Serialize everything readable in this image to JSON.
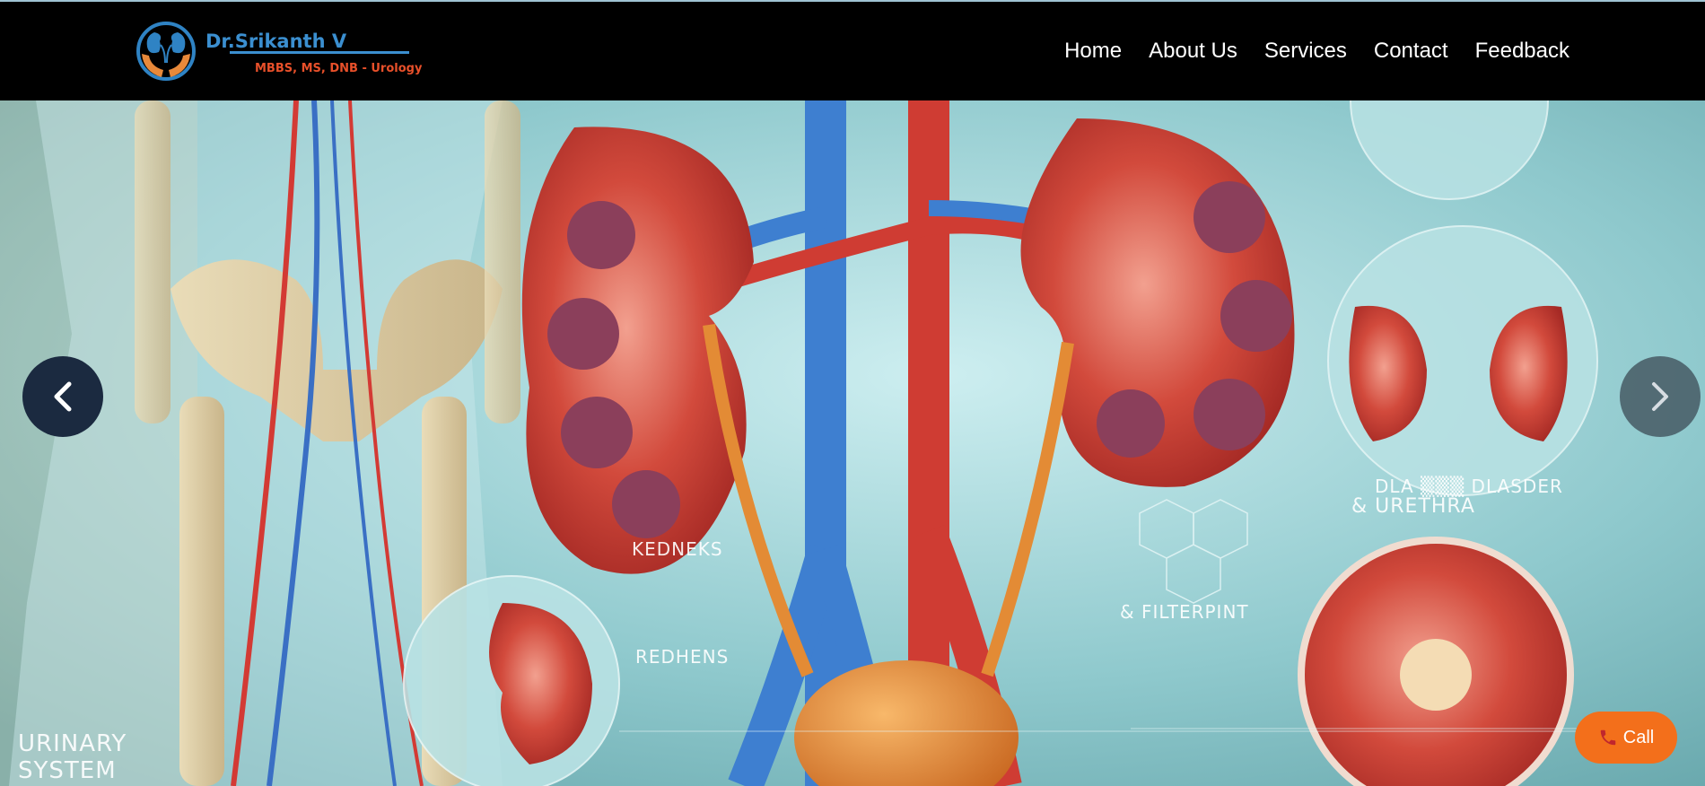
{
  "header": {
    "logo": {
      "name": "Dr.Srikanth V",
      "credentials": "MBBS, MS, DNB - Urology"
    },
    "nav": [
      "Home",
      "About Us",
      "Services",
      "Contact",
      "Feedback"
    ]
  },
  "hero": {
    "image_labels": {
      "urinary_system": "URINARY SYSTEM",
      "kedneks": "KEDNEKS",
      "redhens": "REDHENS",
      "filterpint": "& FILTERPINT",
      "bladder": "DLA ▒▒▒ DLASDER",
      "urethra": "& URETHRA"
    },
    "carousel_icons": [
      "chevron-left-icon",
      "chevron-right-icon"
    ]
  },
  "call_button": {
    "label": "Call",
    "icon": "phone-icon"
  },
  "colors": {
    "header_bg": "#000000",
    "brand_blue": "#3b8fd0",
    "brand_orange": "#e8502a",
    "call_orange": "#f36f1b"
  }
}
